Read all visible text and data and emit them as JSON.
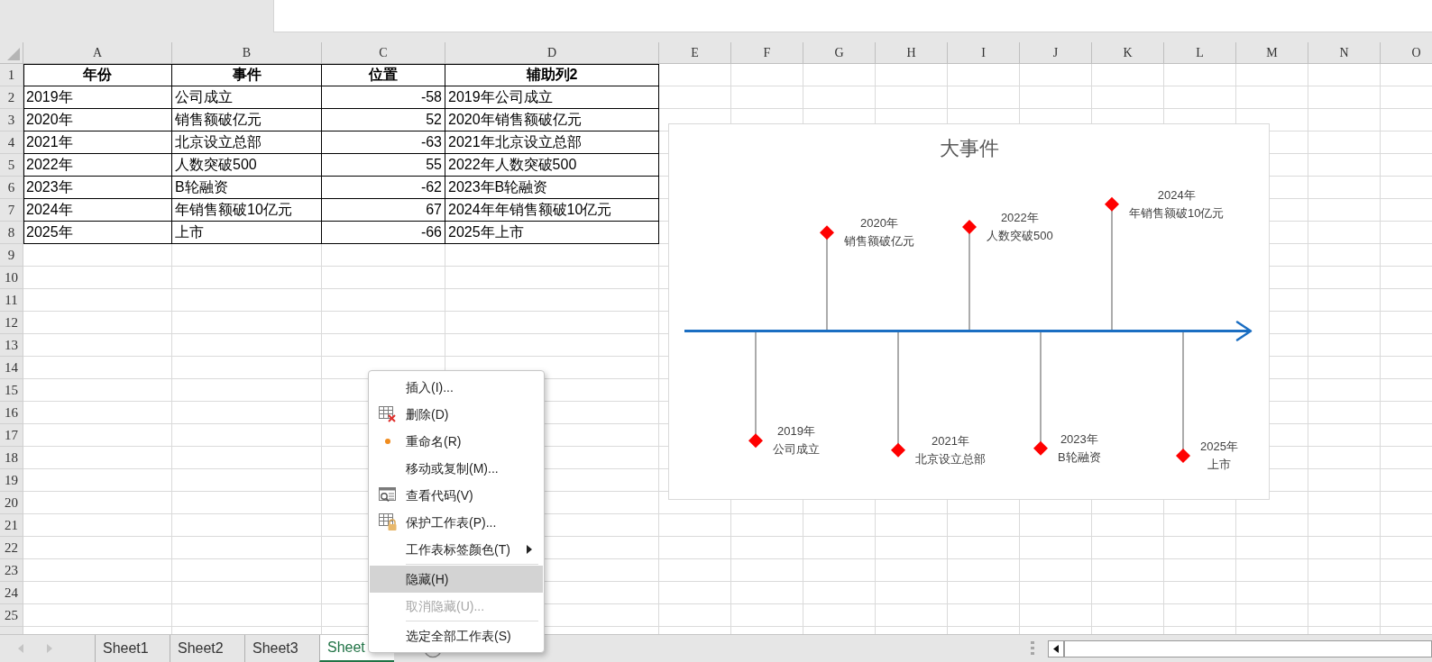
{
  "sheet": {
    "columns": [
      "A",
      "B",
      "C",
      "D",
      "E",
      "F",
      "G",
      "H",
      "I",
      "J",
      "K",
      "L",
      "M",
      "N",
      "O"
    ],
    "row_numbers": [
      "1",
      "2",
      "3",
      "4",
      "5",
      "6",
      "7",
      "8",
      "9",
      "10",
      "11",
      "12",
      "13",
      "14",
      "15",
      "16",
      "17",
      "18",
      "19",
      "20",
      "21",
      "22",
      "23",
      "24",
      "25"
    ]
  },
  "table": {
    "columns": [
      {
        "label": "年份",
        "kind": "text"
      },
      {
        "label": "事件",
        "kind": "text"
      },
      {
        "label": "位置",
        "kind": "number"
      },
      {
        "label": "辅助列2",
        "kind": "text"
      }
    ],
    "rows": [
      [
        "2019年",
        "公司成立",
        "-58",
        "2019年公司成立"
      ],
      [
        "2020年",
        "销售额破亿元",
        "52",
        "2020年销售额破亿元"
      ],
      [
        "2021年",
        "北京设立总部",
        "-63",
        "2021年北京设立总部"
      ],
      [
        "2022年",
        "人数突破500",
        "55",
        "2022年人数突破500"
      ],
      [
        "2023年",
        "B轮融资",
        "-62",
        "2023年B轮融资"
      ],
      [
        "2024年",
        "年销售额破10亿元",
        "67",
        "2024年年销售额破10亿元"
      ],
      [
        "2025年",
        "上市",
        "-66",
        "2025年上市"
      ]
    ]
  },
  "chart": {
    "title": "大事件",
    "labels": [
      {
        "year": "2019年",
        "event": "公司成立"
      },
      {
        "year": "2020年",
        "event": "销售额破亿元"
      },
      {
        "year": "2021年",
        "event": "北京设立总部"
      },
      {
        "year": "2022年",
        "event": "人数突破500"
      },
      {
        "year": "2023年",
        "event": "B轮融资"
      },
      {
        "year": "2024年",
        "event": "年销售额破10亿元"
      },
      {
        "year": "2025年",
        "event": "上市"
      }
    ]
  },
  "context_menu": {
    "items": [
      {
        "kind": "plain",
        "label": "插入(I)...",
        "selected": false,
        "disabled": false
      },
      {
        "kind": "delete",
        "label": "删除(D)",
        "selected": false,
        "disabled": false
      },
      {
        "kind": "rename",
        "label": "重命名(R)",
        "selected": false,
        "disabled": false
      },
      {
        "kind": "plain",
        "label": "移动或复制(M)...",
        "selected": false,
        "disabled": false
      },
      {
        "kind": "view-code",
        "label": "查看代码(V)",
        "selected": false,
        "disabled": false
      },
      {
        "kind": "protect",
        "label": "保护工作表(P)...",
        "selected": false,
        "disabled": false
      },
      {
        "kind": "submenu",
        "label": "工作表标签颜色(T)",
        "selected": false,
        "disabled": false
      },
      {
        "kind": "separator"
      },
      {
        "kind": "plain",
        "label": "隐藏(H)",
        "selected": true,
        "disabled": false
      },
      {
        "kind": "plain",
        "label": "取消隐藏(U)...",
        "selected": false,
        "disabled": true
      },
      {
        "kind": "separator"
      },
      {
        "kind": "plain",
        "label": "选定全部工作表(S)",
        "selected": false,
        "disabled": false
      }
    ]
  },
  "sheet_tabs": [
    {
      "label": "Sheet1",
      "selected": false
    },
    {
      "label": "Sheet2",
      "selected": false
    },
    {
      "label": "Sheet3",
      "selected": false
    },
    {
      "label": "Sheet",
      "selected": true
    }
  ]
}
